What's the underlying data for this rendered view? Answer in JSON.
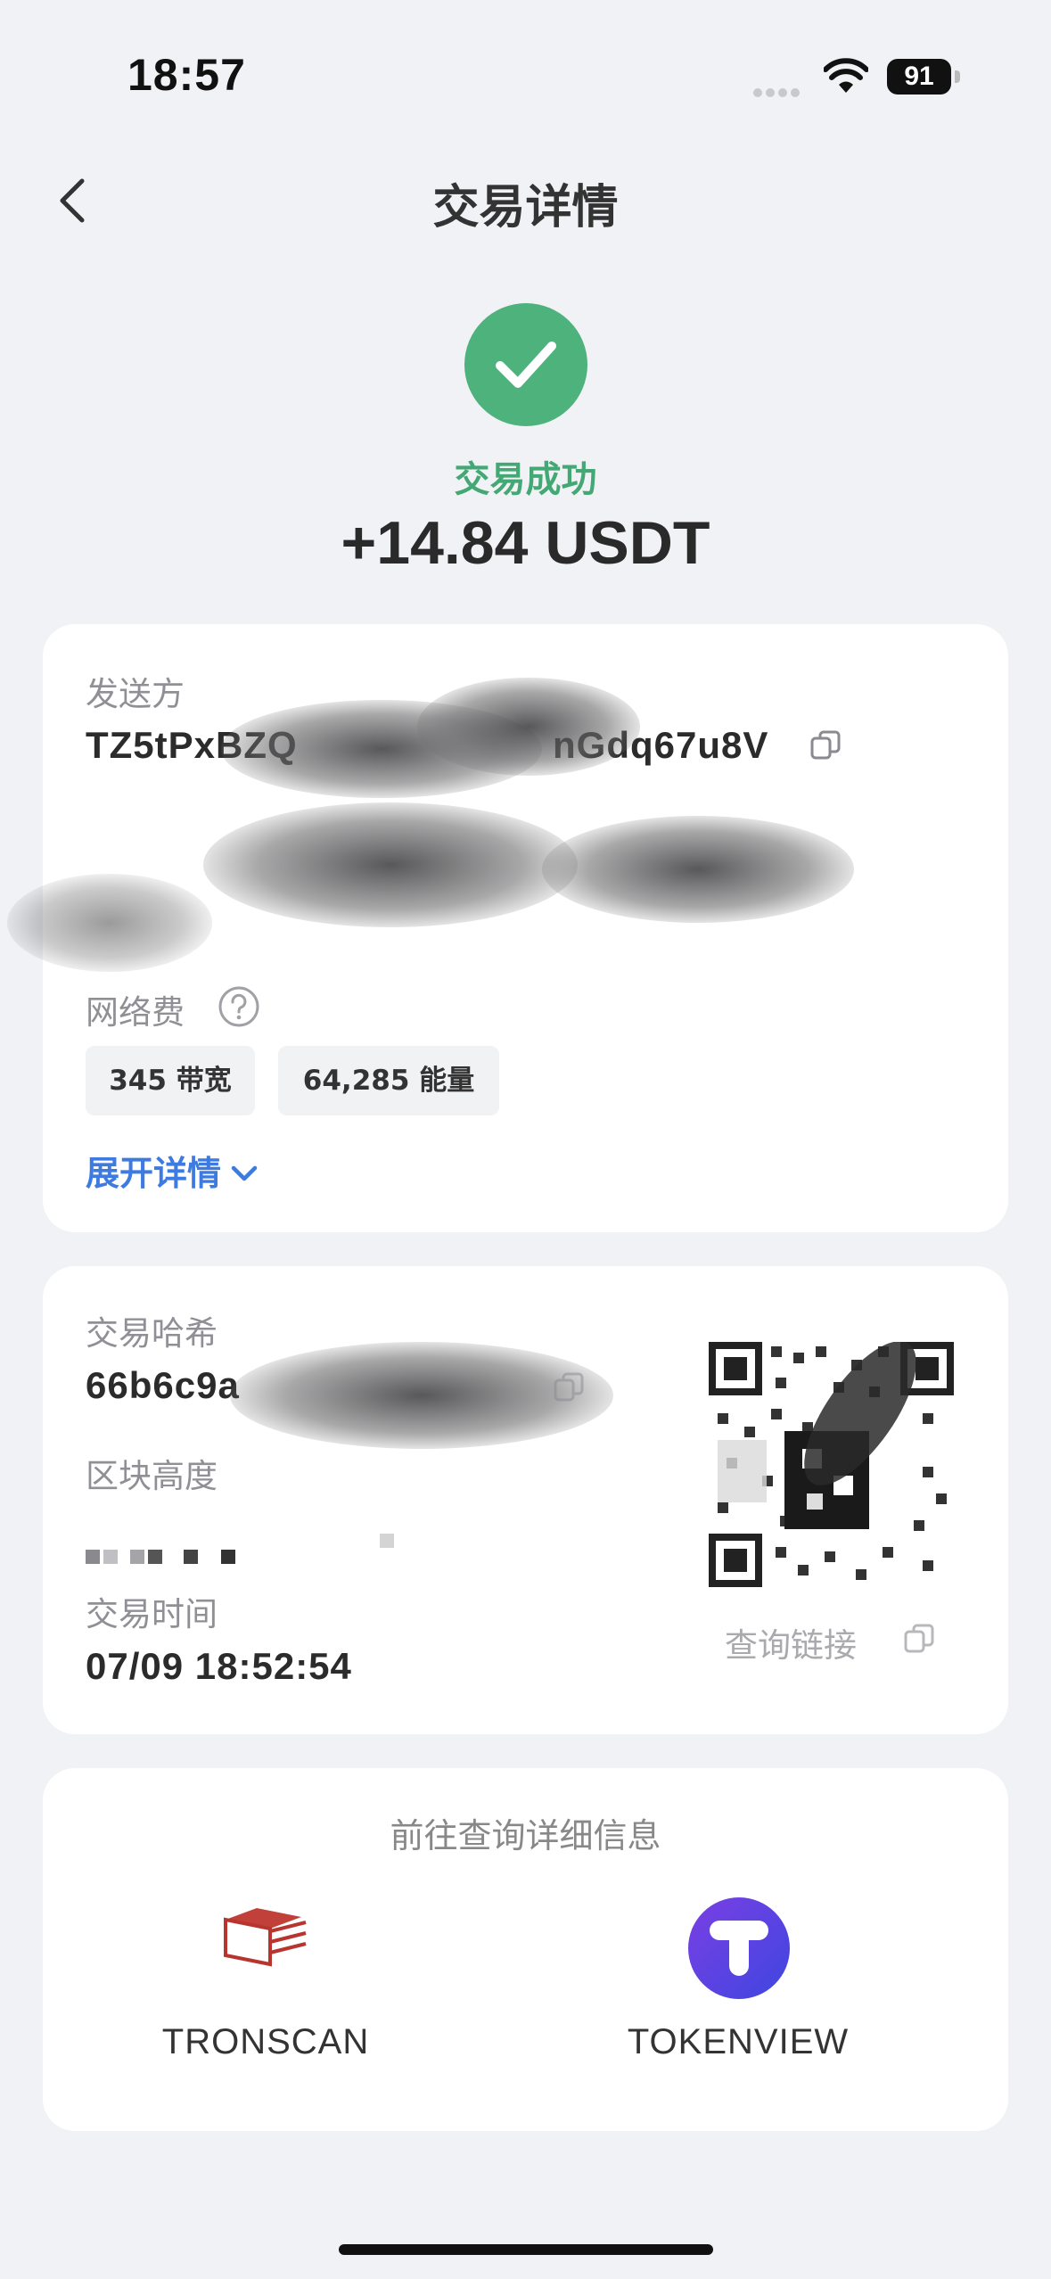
{
  "status_bar": {
    "time": "18:57",
    "battery": "91"
  },
  "nav": {
    "title": "交易详情"
  },
  "hero": {
    "status": "交易成功",
    "amount": "+14.84 USDT"
  },
  "details": {
    "sender_label": "发送方",
    "sender_address": "TZ5tPxBZQ",
    "sender_address_tail": "nGdq67u8V",
    "fee_label": "网络费",
    "fee_chips": [
      "345 带宽",
      "64,285 能量"
    ],
    "expand_label": "展开详情"
  },
  "chain_info": {
    "hash_label": "交易哈希",
    "hash_value": "66b6c9a",
    "block_label": "区块高度",
    "time_label": "交易时间",
    "time_value": "07/09 18:52:54",
    "query_link_label": "查询链接"
  },
  "explorers": {
    "title": "前往查询详细信息",
    "items": [
      {
        "label": "TRONSCAN",
        "icon": "tronscan-icon",
        "color": "#b8352f"
      },
      {
        "label": "TOKENVIEW",
        "icon": "tokenview-icon",
        "color": "#4b3fe0"
      }
    ]
  },
  "colors": {
    "success": "#4db27b",
    "link": "#3e7be0",
    "background": "#f1f2f6"
  }
}
